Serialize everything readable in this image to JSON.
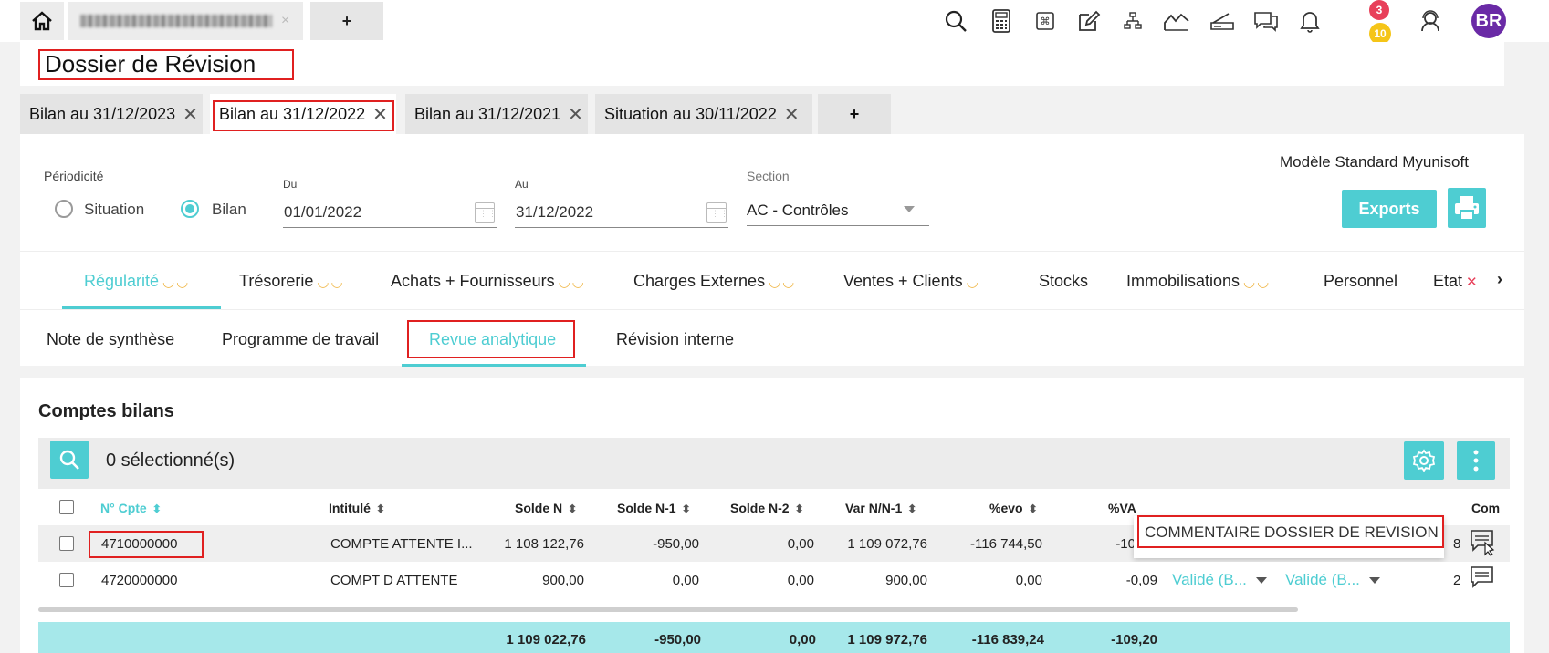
{
  "topbar": {
    "app_tab_close": "×",
    "plus": "+",
    "notif_red_count": "3",
    "notif_yellow_count": "10",
    "avatar_initials": "BR",
    "colors": {
      "red_badge": "#e8405a",
      "yellow_badge": "#f5c518",
      "avatar": "#6a2aa6"
    }
  },
  "page": {
    "title": "Dossier de Révision"
  },
  "doc_tabs": [
    {
      "label": "Bilan au 31/12/2023"
    },
    {
      "label": "Bilan au 31/12/2022"
    },
    {
      "label": "Bilan au 31/12/2021"
    },
    {
      "label": "Situation au 30/11/2022"
    }
  ],
  "doc_tab_plus": "+",
  "filters": {
    "periodicite_label": "Périodicité",
    "option_situation": "Situation",
    "option_bilan": "Bilan",
    "du_label": "Du",
    "du_value": "01/01/2022",
    "au_label": "Au",
    "au_value": "31/12/2022",
    "section_label": "Section",
    "section_value": "AC - Contrôles",
    "modele": "Modèle Standard Myunisoft",
    "exports": "Exports"
  },
  "categories": [
    {
      "label": "Régularité"
    },
    {
      "label": "Trésorerie"
    },
    {
      "label": "Achats + Fournisseurs"
    },
    {
      "label": "Charges Externes"
    },
    {
      "label": "Ventes + Clients"
    },
    {
      "label": "Stocks"
    },
    {
      "label": "Immobilisations"
    },
    {
      "label": "Personnel"
    },
    {
      "label": "Etat"
    }
  ],
  "subtabs": [
    {
      "label": "Note de synthèse"
    },
    {
      "label": "Programme de travail"
    },
    {
      "label": "Revue analytique"
    },
    {
      "label": "Révision interne"
    }
  ],
  "table": {
    "section_title": "Comptes bilans",
    "selected": "0 sélectionné(s)",
    "headers": {
      "compte": "N° Cpte",
      "intitule": "Intitulé",
      "solde_n": "Solde N",
      "solde_n1": "Solde N-1",
      "solde_n2": "Solde N-2",
      "var": "Var N/N-1",
      "evo": "%evo",
      "va": "%VA",
      "com": "Com"
    },
    "rows": [
      {
        "compte": "4710000000",
        "intitule": "COMPTE ATTENTE I...",
        "solde_n": "1 108 122,76",
        "solde_n1": "-950,00",
        "solde_n2": "0,00",
        "var": "1 109 072,76",
        "evo": "-116 744,50",
        "va": "-10",
        "com_count": "8"
      },
      {
        "compte": "4720000000",
        "intitule": "COMPT D ATTENTE",
        "solde_n": "900,00",
        "solde_n1": "0,00",
        "solde_n2": "0,00",
        "var": "900,00",
        "evo": "0,00",
        "va": "-0,09",
        "status1": "Validé (B...",
        "status2": "Validé (B...",
        "com_count": "2"
      }
    ],
    "tooltip": "COMMENTAIRE DOSSIER DE REVISION",
    "totals": {
      "solde_n": "1 109 022,76",
      "solde_n1": "-950,00",
      "solde_n2": "0,00",
      "var": "1 109 972,76",
      "evo": "-116 839,24",
      "va": "-109,20"
    }
  },
  "accent_color": "#4ecdd2"
}
